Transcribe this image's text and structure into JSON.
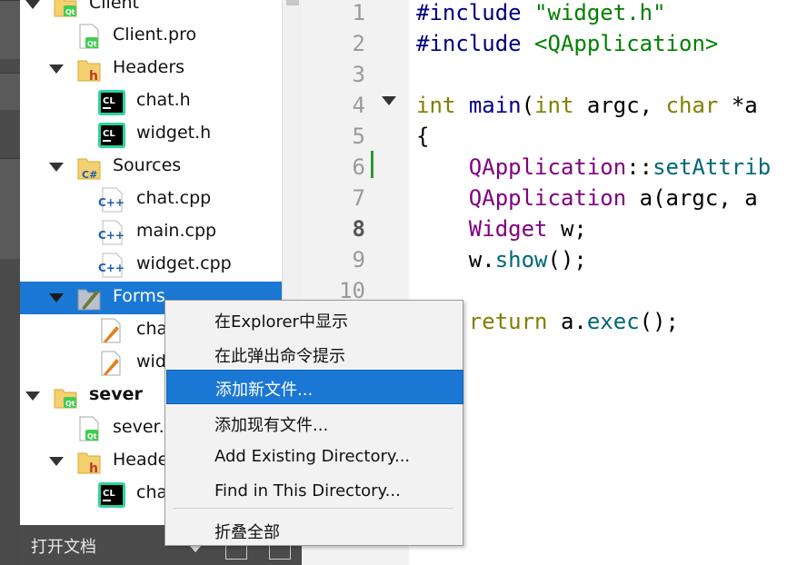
{
  "project_tree": {
    "items": [
      {
        "label": "Client",
        "icon": "qt-folder-icon",
        "expanded": true,
        "bold": false
      },
      {
        "label": "Client.pro",
        "icon": "qt-project-file-icon"
      },
      {
        "label": "Headers",
        "icon": "headers-folder-icon",
        "expanded": true
      },
      {
        "label": "chat.h",
        "icon": "clion-header-icon"
      },
      {
        "label": "widget.h",
        "icon": "clion-header-icon"
      },
      {
        "label": "Sources",
        "icon": "sources-folder-icon",
        "expanded": true
      },
      {
        "label": "chat.cpp",
        "icon": "cpp-file-icon"
      },
      {
        "label": "main.cpp",
        "icon": "cpp-file-icon"
      },
      {
        "label": "widget.cpp",
        "icon": "cpp-file-icon"
      },
      {
        "label": "Forms",
        "icon": "forms-folder-icon",
        "expanded": true,
        "selected": true
      },
      {
        "label": "cha",
        "icon": "ui-form-icon"
      },
      {
        "label": "wid",
        "icon": "ui-form-icon"
      },
      {
        "label": "sever",
        "icon": "qt-folder-icon",
        "expanded": true,
        "bold": true
      },
      {
        "label": "sever.p",
        "icon": "qt-project-file-icon"
      },
      {
        "label": "Heade",
        "icon": "headers-folder-icon",
        "expanded": true
      },
      {
        "label": "cha",
        "icon": "clion-header-icon"
      }
    ]
  },
  "docs_bar": {
    "title": "打开文档"
  },
  "editor": {
    "line_numbers": [
      "1",
      "2",
      "3",
      "4",
      "5",
      "6",
      "7",
      "8",
      "9",
      "10"
    ],
    "current_line": "8",
    "lines": {
      "l1_directive": "#include",
      "l1_target": "\"widget.h\"",
      "l2_directive": "#include",
      "l2_target": "<QApplication>",
      "l4_type1": "int",
      "l4_fn": "main",
      "l4_open": "(",
      "l4_type2": "int",
      "l4_argc": " argc, ",
      "l4_type3": "char",
      "l4_rest": " *a",
      "l5": "{",
      "l6_type": "QApplication",
      "l6_sep": "::",
      "l6_fn": "setAttrib",
      "l7_type": "QApplication",
      "l7_rest": " a(argc, a",
      "l8_type": "Widget",
      "l8_rest": " w;",
      "l9_obj": "w.",
      "l9_fn": "show",
      "l9_rest": "();",
      "l11_kw": "return",
      "l11_obj": " a.",
      "l11_fn": "exec",
      "l11_rest": "();"
    }
  },
  "context_menu": {
    "items": [
      "在Explorer中显示",
      "在此弹出命令提示",
      "添加新文件...",
      "添加现有文件...",
      "Add Existing Directory...",
      "Find in This Directory...",
      "折叠全部"
    ],
    "highlighted_index": 2
  },
  "colors": {
    "selection": "#1a78d4",
    "keyword": "#808000",
    "type": "#800080",
    "string": "#008000",
    "preprocessor": "#000080",
    "function": "#00677c"
  }
}
